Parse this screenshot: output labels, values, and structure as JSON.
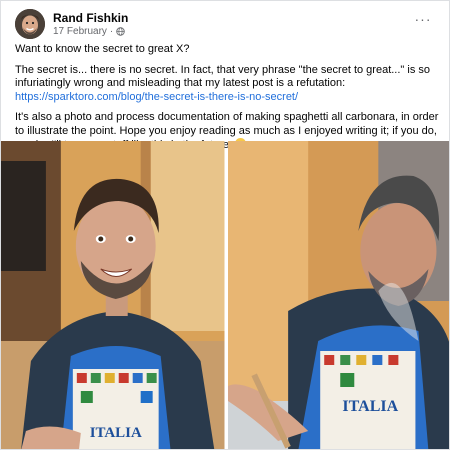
{
  "post": {
    "author": "Rand Fishkin",
    "date": "17 February",
    "separator": "·",
    "privacy_icon": "globe-icon",
    "more_icon": "more-options-icon",
    "more_label": "···",
    "paragraph1": "Want to know the secret to great X?",
    "paragraph2": "The secret is... there is no secret. In fact, that very phrase \"the secret to great...\" is so infuriatingly wrong and misleading that my latest post is a refutation:",
    "link": "https://sparktoro.com/blog/the-secret-is-there-is-no-secret/",
    "paragraph3": "It's also a photo and process documentation of making spaghetti all carbonara, in order to illustrate the point. Hope you enjoy reading as much as I enjoyed writing it; if you do, maybe I'll try more stuff like this in the future.",
    "emoji": "grinning-sweat-emoji"
  },
  "photos": [
    {
      "name": "photo-smiling-man-apron",
      "apron_text": "ITALIA"
    },
    {
      "name": "photo-man-cooking-apron",
      "apron_text": "ITALIA"
    }
  ],
  "colors": {
    "link": "#216fdb",
    "apron": "#2b6fc8",
    "shirt": "#2a3a4c",
    "background_wall": "#d9a259"
  }
}
